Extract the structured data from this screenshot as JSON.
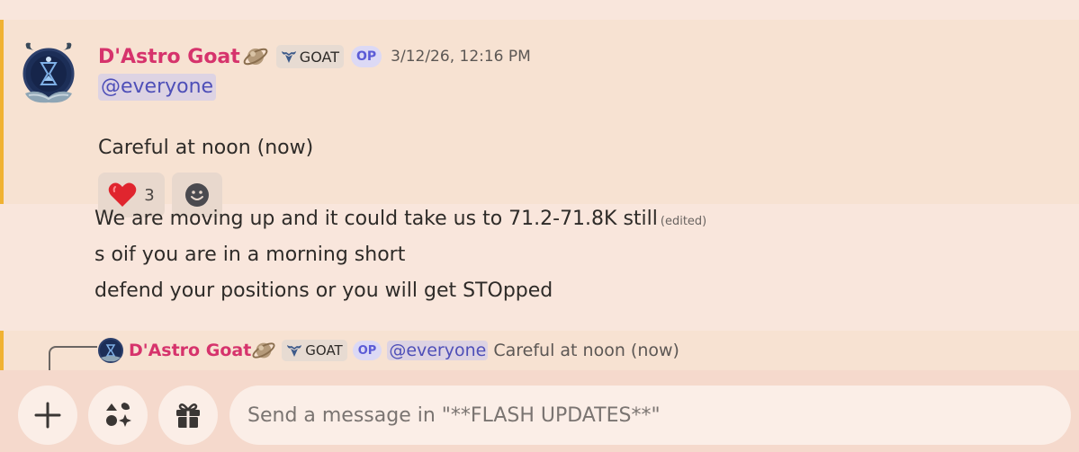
{
  "message": {
    "author": "D'Astro Goat",
    "role_tag": "GOAT",
    "op_badge": "OP",
    "timestamp": "3/12/26, 12:16 PM",
    "mention": "@everyone",
    "text": "Careful at noon (now)",
    "reactions": [
      {
        "emoji": "red-heart",
        "count": "3"
      },
      {
        "emoji": "add-reaction"
      }
    ]
  },
  "followups": [
    {
      "text": "We are moving up and it could take us to 71.2-71.8K still",
      "edited": "(edited)"
    },
    {
      "text": "s oif you are in a morning short"
    },
    {
      "text": "defend your positions or you will get STOpped"
    }
  ],
  "reply": {
    "author": "D'Astro Goat",
    "role_tag": "GOAT",
    "op_badge": "OP",
    "mention": "@everyone",
    "text": "Careful at noon (now)"
  },
  "composer": {
    "placeholder": "Send a message in \"**FLASH UPDATES**\"",
    "buttons": [
      "plus-icon",
      "apps-icon",
      "gift-icon"
    ]
  },
  "colors": {
    "accent_bar": "#f0b232",
    "username": "#d6336c",
    "mention": "#4e4fb8"
  }
}
